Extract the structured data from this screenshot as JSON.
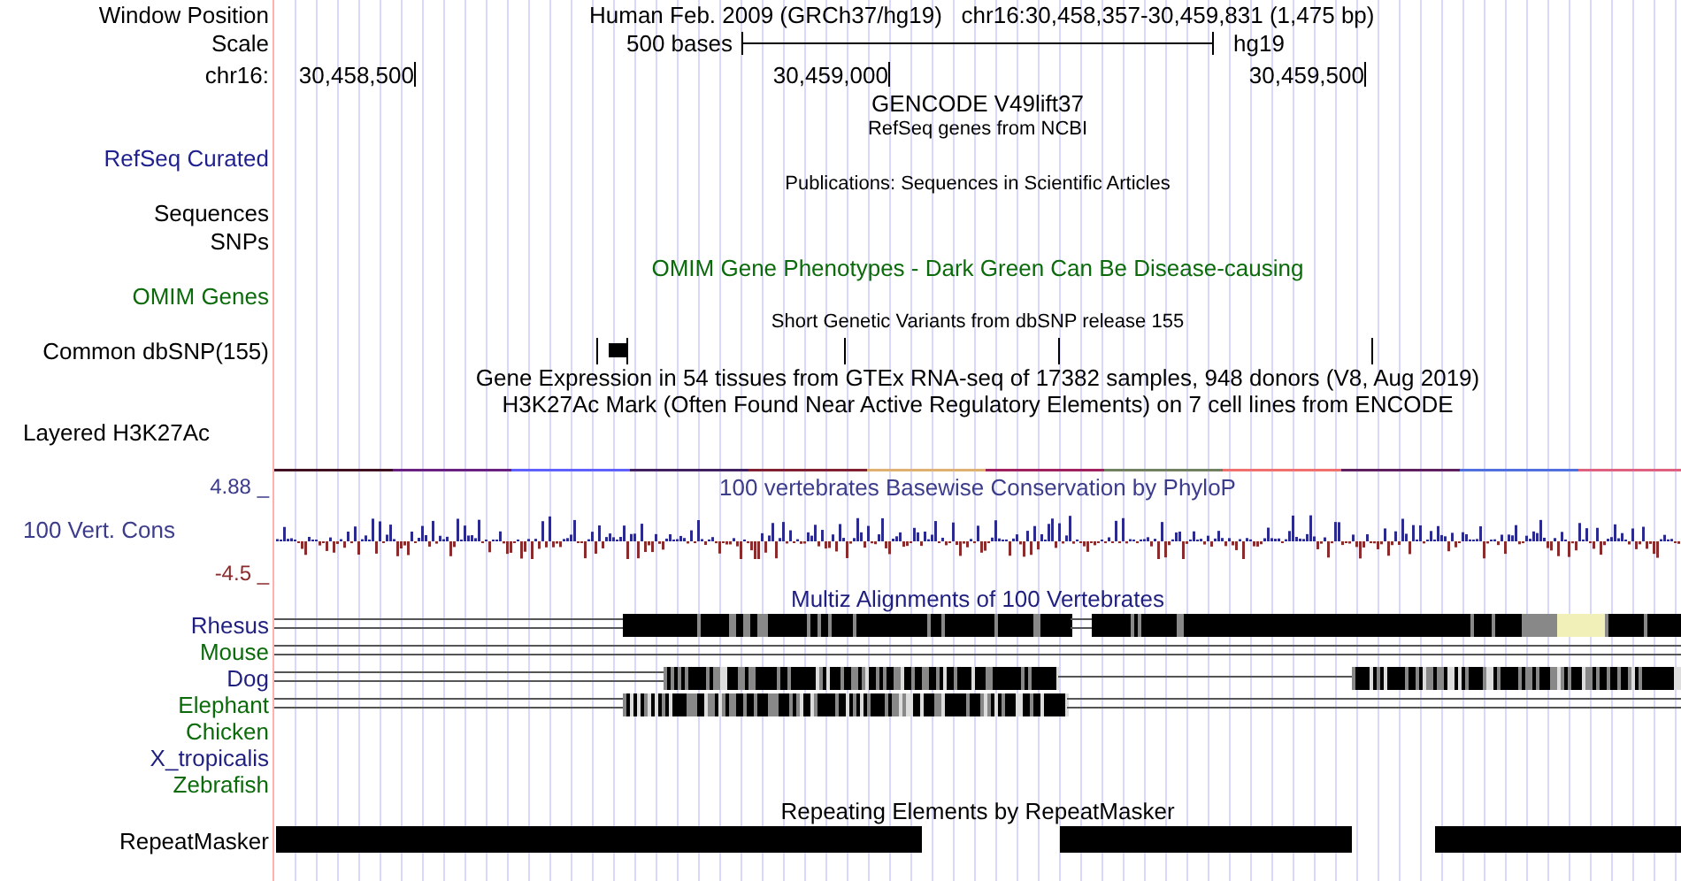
{
  "header": {
    "position_label": "Window Position",
    "position_text": "Human Feb. 2009 (GRCh37/hg19)   chr16:30,458,357-30,459,831 (1,475 bp)",
    "scale_label": "Scale",
    "scale_text": "500 bases",
    "assembly": "hg19",
    "chrom_label": "chr16:",
    "ticks": [
      "30,458,500",
      "30,459,000",
      "30,459,500"
    ]
  },
  "rows": [
    {
      "kind": "title",
      "text": "GENCODE V49lift37"
    },
    {
      "kind": "subtitle",
      "text": "RefSeq genes from NCBI"
    },
    {
      "kind": "label",
      "label": "RefSeq Curated",
      "color": "#1f1f8f"
    },
    {
      "kind": "subtitle",
      "text": "Publications: Sequences in Scientific Articles"
    },
    {
      "kind": "label",
      "label": "Sequences",
      "color": "#000000"
    },
    {
      "kind": "label",
      "label": "SNPs",
      "color": "#000000"
    },
    {
      "kind": "title",
      "text": "OMIM Gene Phenotypes - Dark Green Can Be Disease-causing",
      "color": "#0b6b0b"
    },
    {
      "kind": "label",
      "label": "OMIM Genes",
      "color": "#0b6b0b"
    },
    {
      "kind": "subtitle",
      "text": "Short Genetic Variants from dbSNP release 155"
    },
    {
      "kind": "snp",
      "label": "Common dbSNP(155)",
      "color": "#000000"
    },
    {
      "kind": "title",
      "text": "Gene Expression in 54 tissues from GTEx RNA-seq of 17382 samples, 948 donors (V8, Aug 2019)"
    },
    {
      "kind": "title",
      "text": "H3K27Ac Mark (Often Found Near Active Regulatory Elements) on 7 cell lines from ENCODE"
    },
    {
      "kind": "left_label",
      "label": "Layered H3K27Ac",
      "color": "#000000"
    },
    {
      "kind": "signal"
    }
  ],
  "conservation": {
    "max": "4.88 _",
    "title": "100 vertebrates Basewise Conservation by PhyloP",
    "label": "100 Vert. Cons",
    "min": "-4.5 _"
  },
  "multiz": {
    "title": "Multiz Alignments of 100 Vertebrates",
    "species": [
      {
        "name": "Rhesus",
        "color": "#1f1f80"
      },
      {
        "name": "Mouse",
        "color": "#0b6b0b"
      },
      {
        "name": "Dog",
        "color": "#1f1f80"
      },
      {
        "name": "Elephant",
        "color": "#0b6b0b"
      },
      {
        "name": "Chicken",
        "color": "#0b6b0b"
      },
      {
        "name": "X_tropicalis",
        "color": "#1f1f80"
      },
      {
        "name": "Zebrafish",
        "color": "#0b6b0b"
      }
    ]
  },
  "repeats": {
    "title": "Repeating Elements by RepeatMasker",
    "label": "RepeatMasker"
  }
}
